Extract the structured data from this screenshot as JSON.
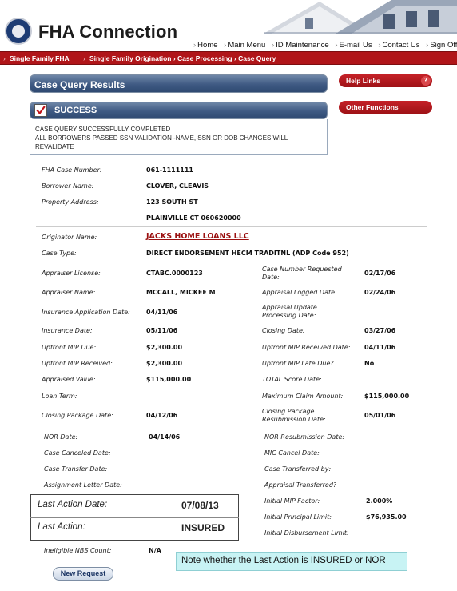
{
  "header": {
    "logo_text": "FHA Connection",
    "nav": [
      "Home",
      "Main Menu",
      "ID Maintenance",
      "E-mail Us",
      "Contact Us",
      "Sign Off"
    ]
  },
  "breadcrumb": {
    "left": "Single Family FHA",
    "path": "Single Family Origination › Case Processing › Case Query"
  },
  "results_title": "Case Query Results",
  "success": {
    "title": "SUCCESS",
    "lines": [
      "CASE QUERY SUCCESSFULLY COMPLETED",
      "ALL BORROWERS PASSED SSN VALIDATION -NAME, SSN OR DOB CHANGES WILL",
      "REVALIDATE"
    ]
  },
  "side_buttons": {
    "help": "Help Links",
    "help_icon": "?",
    "other": "Other Functions"
  },
  "case": {
    "fha_case_number_label": "FHA Case Number:",
    "fha_case_number": "061-1111111",
    "borrower_label": "Borrower Name:",
    "borrower": "CLOVER, CLEAVIS",
    "property_label": "Property Address:",
    "address1": "123 SOUTH ST",
    "address2": "PLAINVILLE CT 060620000"
  },
  "details": {
    "originator_label": "Originator Name:",
    "originator": "JACKS HOME LOANS LLC",
    "case_type_label": "Case Type:",
    "case_type": "DIRECT ENDORSEMENT HECM TRADITNL (ADP Code 952)",
    "appraiser_license_label": "Appraiser License:",
    "appraiser_license": "CTABC.0000123",
    "case_num_req_label": "Case Number Requested Date:",
    "case_num_req": "02/17/06",
    "appraiser_name_label": "Appraiser Name:",
    "appraiser_name": "MCCALL, MICKEE M",
    "appraisal_logged_label": "Appraisal Logged Date:",
    "appraisal_logged": "02/24/06",
    "ins_app_label": "Insurance Application Date:",
    "ins_app": "04/11/06",
    "appraisal_update_label": "Appraisal Update Processing Date:",
    "appraisal_update": "",
    "ins_date_label": "Insurance Date:",
    "ins_date": "05/11/06",
    "closing_date_label": "Closing Date:",
    "closing_date": "03/27/06",
    "upfront_due_label": "Upfront MIP Due:",
    "upfront_due": "$2,300.00",
    "upfront_rec_date_label": "Upfront MIP Received Date:",
    "upfront_rec_date": "04/11/06",
    "upfront_rec_label": "Upfront MIP Received:",
    "upfront_rec": "$2,300.00",
    "upfront_late_label": "Upfront MIP Late Due?",
    "upfront_late": "No",
    "appraised_label": "Appraised Value:",
    "appraised": "$115,000.00",
    "total_score_label": "TOTAL Score Date:",
    "total_score": "",
    "loan_term_label": "Loan Term:",
    "loan_term": "",
    "max_claim_label": "Maximum Claim Amount:",
    "max_claim": "$115,000.00",
    "closing_pkg_label": "Closing Package Date:",
    "closing_pkg": "04/12/06",
    "closing_resub_label": "Closing Package Resubmission Date:",
    "closing_resub": "05/01/06",
    "nor_label": "NOR Date:",
    "nor": "04/14/06",
    "nor_resub_label": "NOR Resubmission Date:",
    "nor_resub": "",
    "case_canceled_label": "Case Canceled Date:",
    "case_canceled": "",
    "mic_cancel_label": "MIC Cancel Date:",
    "mic_cancel": "",
    "case_transfer_label": "Case Transfer Date:",
    "case_transfer": "",
    "case_transferred_by_label": "Case Transferred by:",
    "case_transferred_by": "",
    "assignment_letter_label": "Assignment Letter Date:",
    "assignment_letter": "",
    "appraisal_transferred_label": "Appraisal Transferred?",
    "appraisal_transferred": "",
    "initial_mip_label": "Initial MIP Factor:",
    "initial_mip": "2.000%",
    "initial_principal_label": "Initial Principal Limit:",
    "initial_principal": "$76,935.00",
    "initial_disb_label": "Initial Disbursement Limit:",
    "initial_disb": "",
    "ineligible_label": "Ineligible NBS Count:",
    "ineligible": "N/A"
  },
  "last_action": {
    "date_label": "Last Action Date:",
    "date": "07/08/13",
    "action_label": "Last Action:",
    "action": "INSURED"
  },
  "callout": "Note whether the Last Action is INSURED or NOR",
  "new_request": "New Request",
  "colors": {
    "brand_red": "#b01519",
    "panel_blue": "#3f5a83",
    "link_red": "#9b1111",
    "callout_bg": "#c8f3f4"
  },
  "icons": {
    "seal": "hud-seal-icon",
    "check": "checkmark-icon",
    "help": "question-icon"
  }
}
